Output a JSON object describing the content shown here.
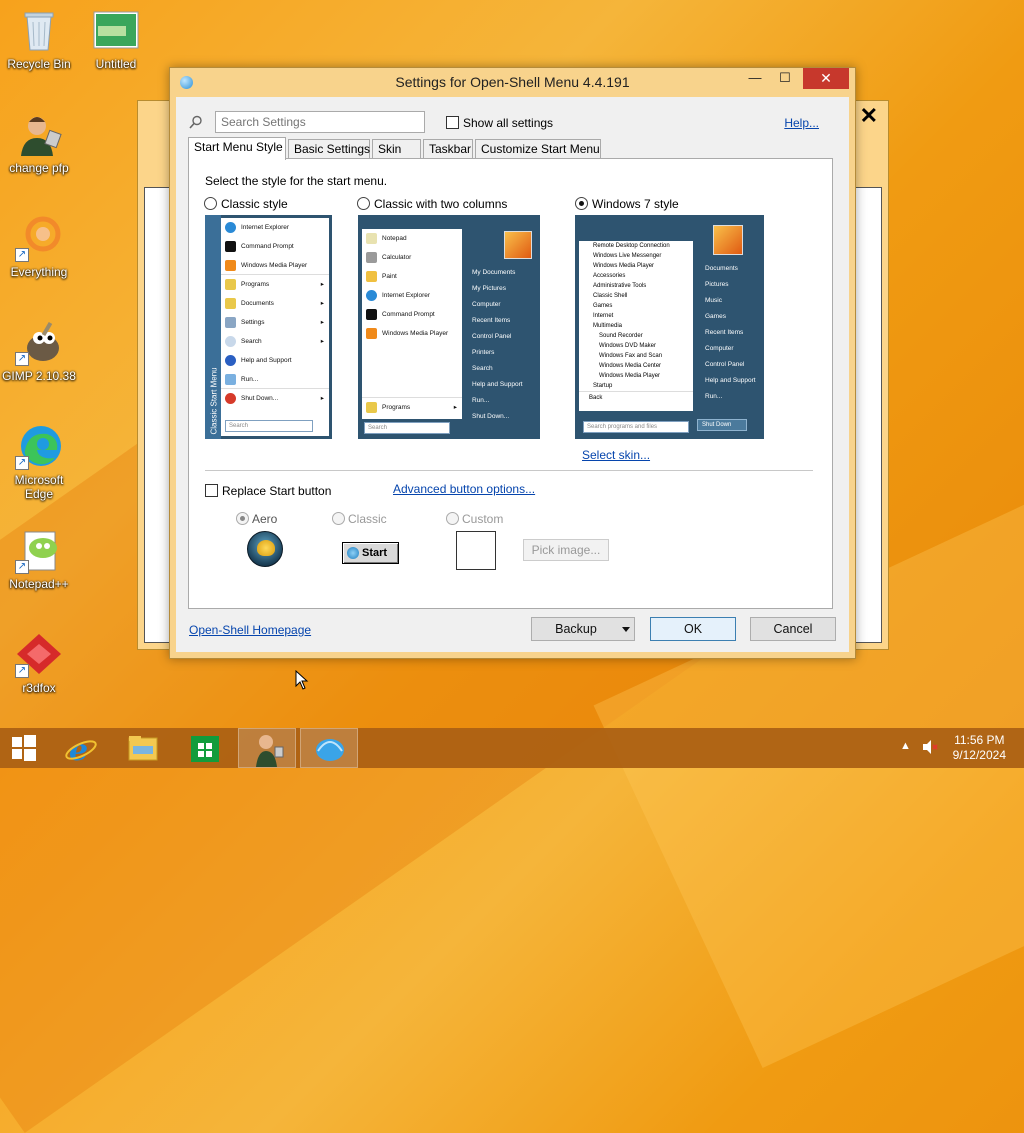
{
  "desktop": {
    "icons": [
      {
        "label": "Recycle Bin"
      },
      {
        "label": "Untitled"
      },
      {
        "label": "change pfp"
      },
      {
        "label": "Everything"
      },
      {
        "label": "GIMP 2.10.38"
      },
      {
        "label": "Microsoft Edge"
      },
      {
        "label": "Notepad++"
      },
      {
        "label": "r3dfox"
      }
    ]
  },
  "dialog": {
    "title": "Settings for Open-Shell Menu 4.4.191",
    "search_placeholder": "Search Settings",
    "show_all_label": "Show all settings",
    "help_label": "Help...",
    "tabs": [
      {
        "label": "Start Menu Style",
        "active": true
      },
      {
        "label": "Basic Settings"
      },
      {
        "label": "Skin"
      },
      {
        "label": "Taskbar"
      },
      {
        "label": "Customize Start Menu"
      }
    ],
    "section_label": "Select the style for the start menu.",
    "styles": [
      {
        "label": "Classic style",
        "selected": false
      },
      {
        "label": "Classic with two columns",
        "selected": false
      },
      {
        "label": "Windows 7 style",
        "selected": true
      }
    ],
    "preview_classic": {
      "items": [
        "Internet Explorer",
        "Command Prompt",
        "Windows Media Player",
        "Programs",
        "Documents",
        "Settings",
        "Search",
        "Help and Support",
        "Run...",
        "Shut Down..."
      ],
      "side_label": "Classic Start Menu",
      "search_placeholder": "Search"
    },
    "preview_two_col": {
      "left_items": [
        "Notepad",
        "Calculator",
        "Paint",
        "Internet Explorer",
        "Command Prompt",
        "Windows Media Player"
      ],
      "programs": "Programs",
      "right_items": [
        "My Documents",
        "My Pictures",
        "Computer",
        "Recent Items",
        "Control Panel",
        "Printers",
        "Search",
        "Help and Support",
        "Run...",
        "Shut Down..."
      ],
      "search_placeholder": "Search"
    },
    "preview_win7": {
      "left_items": [
        "Remote Desktop Connection",
        "Windows Live Messenger",
        "Windows Media Player",
        "Accessories",
        "Administrative Tools",
        "Classic Shell",
        "Games",
        "Internet",
        "Multimedia",
        "Sound Recorder",
        "Windows DVD Maker",
        "Windows Fax and Scan",
        "Windows Media Center",
        "Windows Media Player",
        "Startup"
      ],
      "back": "Back",
      "search_placeholder": "Search programs and files",
      "right_items": [
        "Documents",
        "Pictures",
        "Music",
        "Games",
        "Recent Items",
        "Computer",
        "Control Panel",
        "Help and Support",
        "Run..."
      ],
      "shutdown": "Shut Down"
    },
    "select_skin_label": "Select skin...",
    "replace_start_label": "Replace Start button",
    "advanced_label": "Advanced button options...",
    "button_styles": [
      {
        "label": "Aero",
        "selected": true
      },
      {
        "label": "Classic",
        "selected": false
      },
      {
        "label": "Custom",
        "selected": false
      }
    ],
    "classic_start_label": "Start",
    "pick_image_label": "Pick image...",
    "homepage_label": "Open-Shell Homepage",
    "backup_label": "Backup",
    "ok_label": "OK",
    "cancel_label": "Cancel"
  },
  "taskbar": {
    "time": "11:56 PM",
    "date": "9/12/2024"
  }
}
